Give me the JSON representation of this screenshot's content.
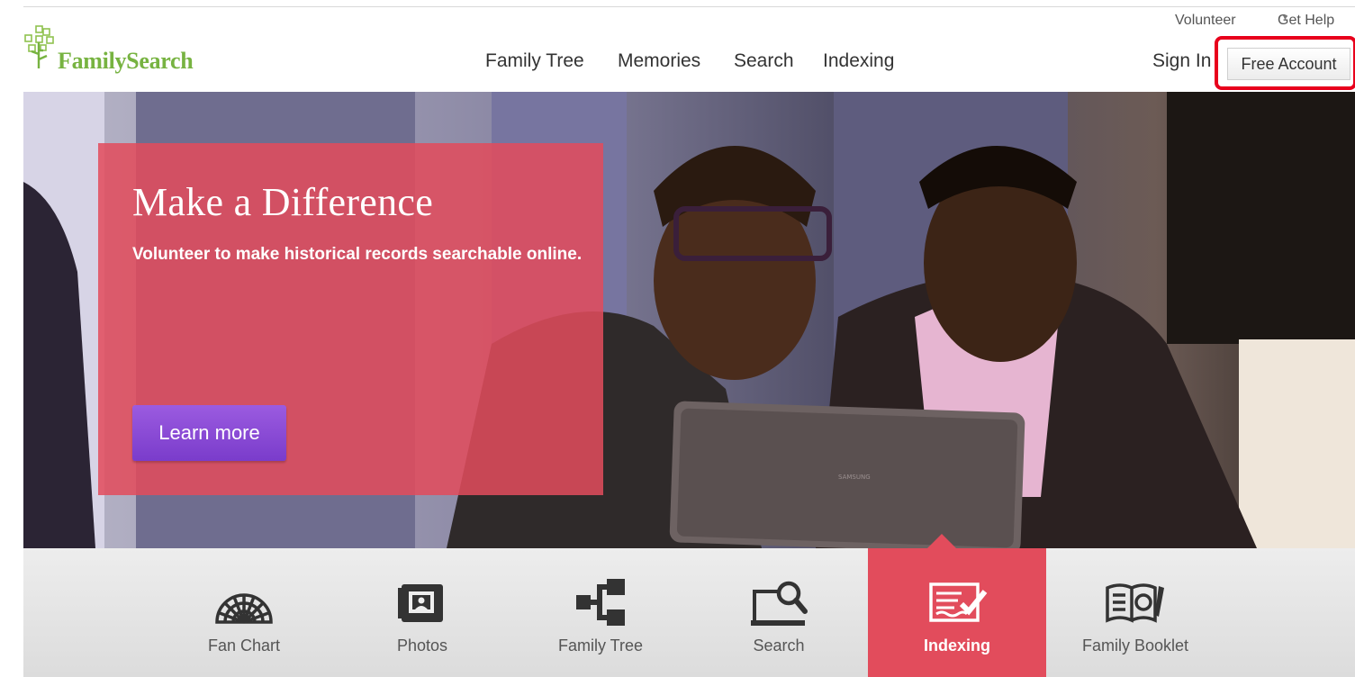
{
  "header": {
    "logo_text": "FamilySearch",
    "utility_links": [
      "Volunteer",
      "Get Help"
    ],
    "nav": [
      "Family Tree",
      "Memories",
      "Search",
      "Indexing"
    ],
    "sign_in": "Sign In",
    "free_account": "Free Account"
  },
  "hero": {
    "title": "Make a Difference",
    "subtitle": "Volunteer to make historical records searchable online.",
    "cta": "Learn more",
    "tablet_brand": "SAMSUNG"
  },
  "features": [
    {
      "label": "Fan Chart",
      "icon": "fan-chart-icon"
    },
    {
      "label": "Photos",
      "icon": "photos-icon"
    },
    {
      "label": "Family Tree",
      "icon": "family-tree-icon"
    },
    {
      "label": "Search",
      "icon": "search-icon"
    },
    {
      "label": "Indexing",
      "icon": "indexing-icon",
      "active": true
    },
    {
      "label": "Family Booklet",
      "icon": "family-booklet-icon"
    }
  ],
  "colors": {
    "brand_green": "#77b341",
    "accent_red": "#e24c5c",
    "cta_purple": "#8a4bd6",
    "highlight_red": "#e8001c"
  }
}
